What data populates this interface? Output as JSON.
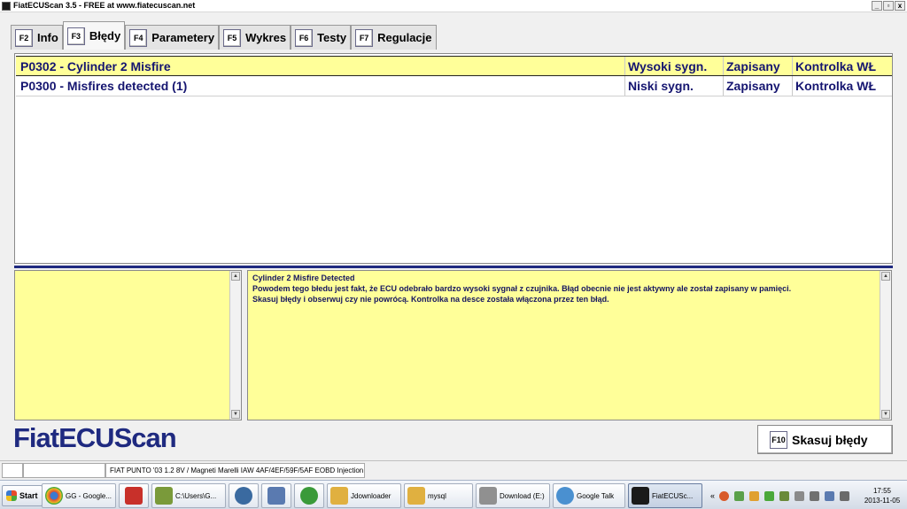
{
  "window": {
    "title": "FiatECUScan 3.5 - FREE at www.fiatecuscan.net",
    "buttons": [
      "_",
      "▫",
      "x"
    ]
  },
  "tabs": [
    {
      "key": "F2",
      "label": "Info"
    },
    {
      "key": "F3",
      "label": "Błędy",
      "active": true
    },
    {
      "key": "F4",
      "label": "Parametery"
    },
    {
      "key": "F5",
      "label": "Wykres"
    },
    {
      "key": "F6",
      "label": "Testy"
    },
    {
      "key": "F7",
      "label": "Regulacje"
    }
  ],
  "errors": [
    {
      "code": "P0302 - Cylinder 2 Misfire",
      "level": "Wysoki sygn.",
      "stored": "Zapisany",
      "mil": "Kontrolka WŁ",
      "selected": true
    },
    {
      "code": "P0300 - Misfires detected (1)",
      "level": "Niski sygn.",
      "stored": "Zapisany",
      "mil": "Kontrolka WŁ",
      "selected": false
    }
  ],
  "description": {
    "title": "Cylinder 2 Misfire Detected",
    "lines": [
      "Powodem tego błedu jest fakt, że ECU odebrało bardzo wysoki sygnał z czujnika. Błąd obecnie nie jest aktywny ale został zapisany w pamięci.",
      "Skasuj błędy i obserwuj czy nie powrócą. Kontrolka na desce została włączona przez ten błąd."
    ]
  },
  "logo": "FiatECUScan",
  "clear_button": {
    "key": "F10",
    "label": "Skasuj błędy"
  },
  "statusbar": {
    "cell1": "",
    "cell2": "",
    "vehicle": "FIAT PUNTO '03 1.2 8V / Magneti Marelli IAW 4AF/4EF/59F/5AF EOBD Injection"
  },
  "taskbar": {
    "start_label": "Start",
    "items": [
      {
        "label": "GG - Google...",
        "icon": "chrome-icon",
        "color": "#d94a38"
      },
      {
        "label": "",
        "icon": "filezilla-icon",
        "color": "#c8302a"
      },
      {
        "label": "C:\\Users\\G...",
        "icon": "cmd-icon",
        "color": "#7a9a3a"
      },
      {
        "label": "",
        "icon": "thunderbird-icon",
        "color": "#3a6aa0"
      },
      {
        "label": "",
        "icon": "network-icon",
        "color": "#5a7ab0"
      },
      {
        "label": "",
        "icon": "hs-icon",
        "color": "#3a9a3a"
      },
      {
        "label": "Jdownloader",
        "icon": "folder-icon",
        "color": "#e0b040"
      },
      {
        "label": "mysql",
        "icon": "folder-icon",
        "color": "#e0b040"
      },
      {
        "label": "Download (E:)",
        "icon": "drive-icon",
        "color": "#909090"
      },
      {
        "label": "Google Talk",
        "icon": "gtalk-icon",
        "color": "#4a90d0"
      },
      {
        "label": "FiatECUSc...",
        "icon": "fiatecuscan-icon",
        "color": "#1a1a1a",
        "active": true
      }
    ],
    "clock": {
      "time": "17:55",
      "date": "2013-11-05"
    }
  },
  "colors": {
    "accent": "#1f2a80",
    "highlight": "#ffff99",
    "text_blue": "#151570"
  }
}
